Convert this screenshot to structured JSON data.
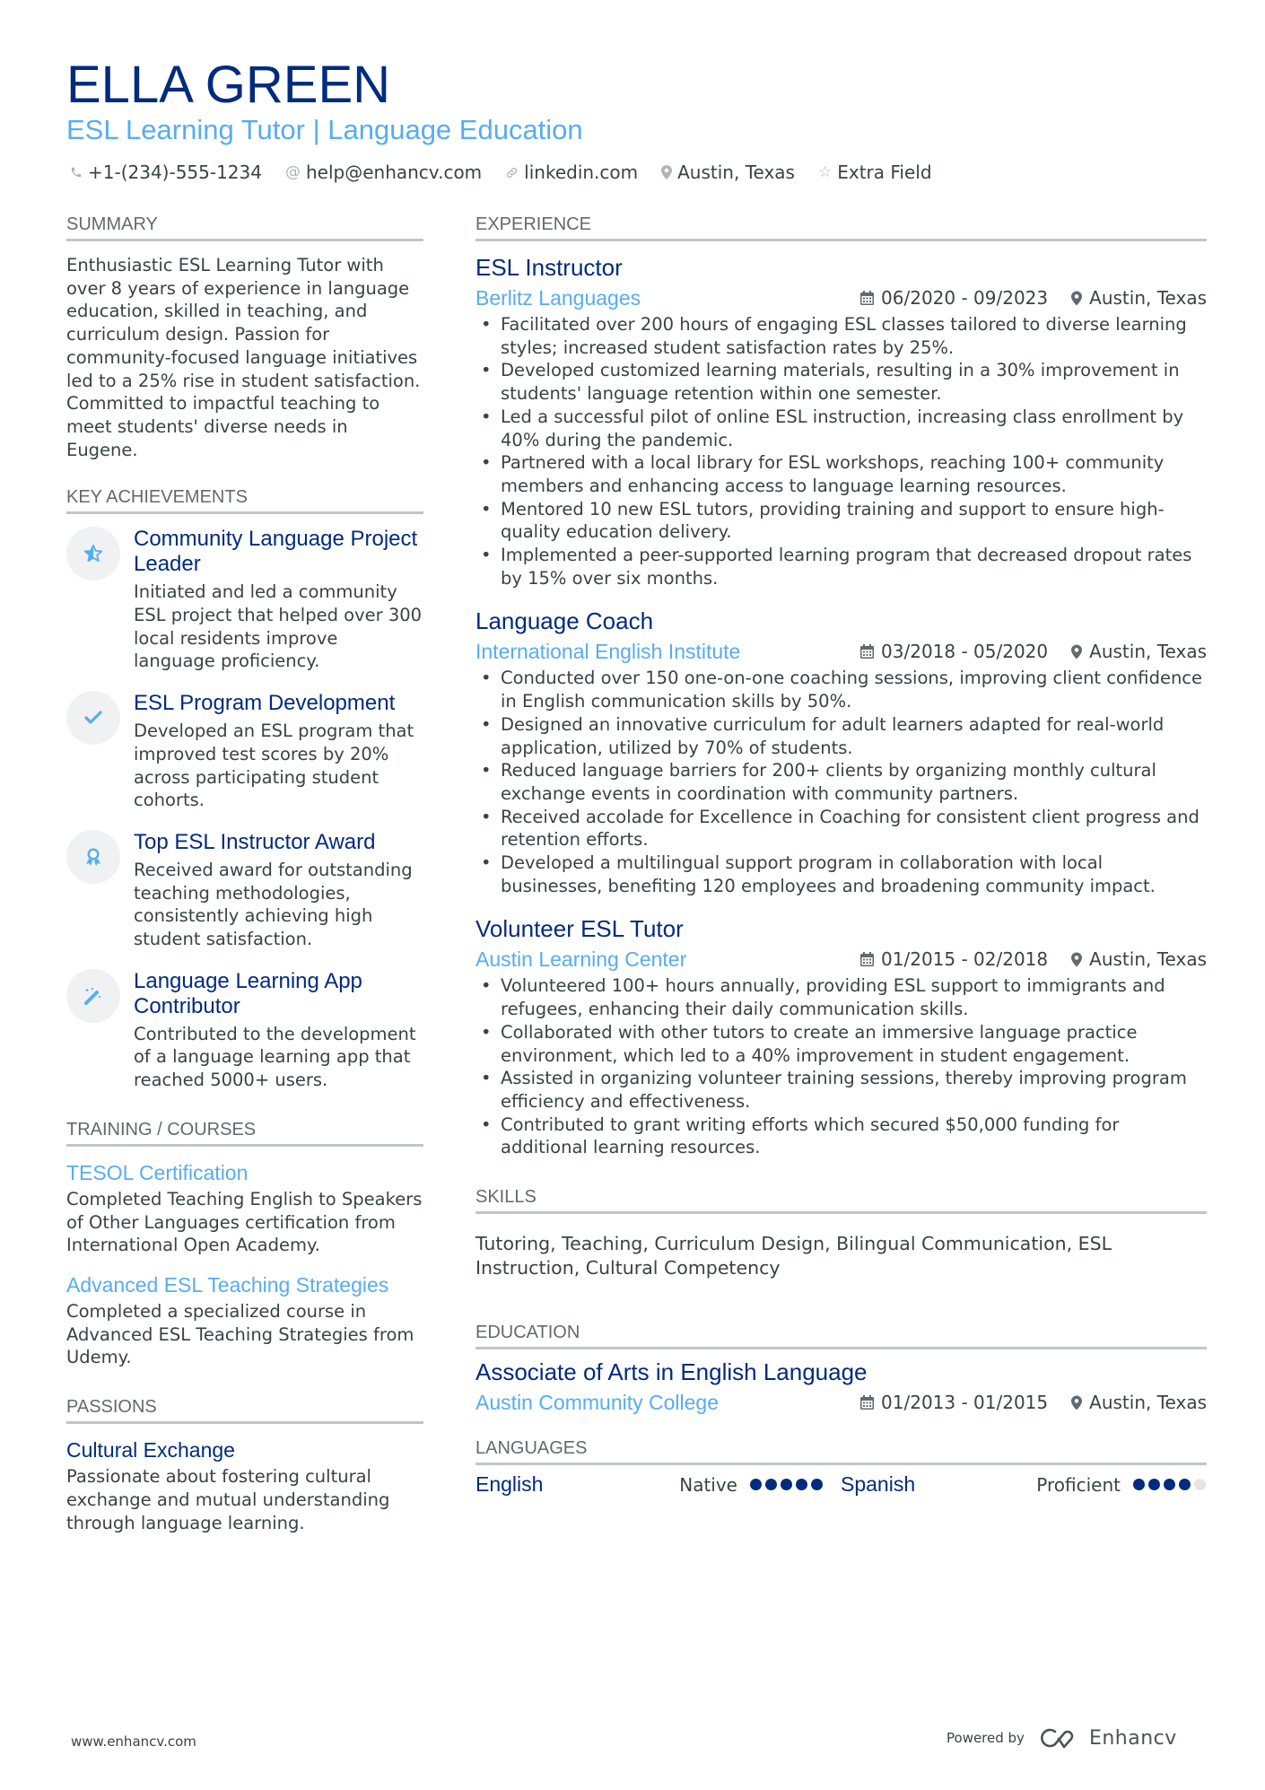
{
  "header": {
    "name": "ELLA GREEN",
    "title": "ESL Learning Tutor | Language Education",
    "contacts": [
      {
        "icon": "phone-icon",
        "text": "+1-(234)-555-1234"
      },
      {
        "icon": "at-icon",
        "text": "help@enhancv.com"
      },
      {
        "icon": "link-icon",
        "text": "linkedin.com"
      },
      {
        "icon": "location-pin-icon",
        "text": "Austin, Texas"
      },
      {
        "icon": "star-icon",
        "text": "Extra Field"
      }
    ]
  },
  "summary": {
    "heading": "SUMMARY",
    "text": "Enthusiastic ESL Learning Tutor with over 8 years of experience in language education, skilled in teaching, and curriculum design. Passion for community-focused language initiatives led to a 25% rise in student satisfaction. Committed to impactful teaching to meet students' diverse needs in Eugene."
  },
  "achievements": {
    "heading": "KEY ACHIEVEMENTS",
    "items": [
      {
        "icon": "star-half-icon",
        "title": "Community Language Project Leader",
        "text": "Initiated and led a community ESL project that helped over 300 local residents improve language proficiency."
      },
      {
        "icon": "checkmark-icon",
        "title": "ESL Program Development",
        "text": "Developed an ESL program that improved test scores by 20% across participating student cohorts."
      },
      {
        "icon": "award-ribbon-icon",
        "title": "Top ESL Instructor Award",
        "text": "Received award for outstanding teaching methodologies, consistently achieving high student satisfaction."
      },
      {
        "icon": "magic-wand-icon",
        "title": "Language Learning App Contributor",
        "text": "Contributed to the development of a language learning app that reached 5000+ users."
      }
    ]
  },
  "training": {
    "heading": "TRAINING / COURSES",
    "items": [
      {
        "title": "TESOL Certification",
        "text": "Completed Teaching English to Speakers of Other Languages certification from International Open Academy."
      },
      {
        "title": "Advanced ESL Teaching Strategies",
        "text": "Completed a specialized course in Advanced ESL Teaching Strategies from Udemy."
      }
    ]
  },
  "passions": {
    "heading": "PASSIONS",
    "items": [
      {
        "title": "Cultural Exchange",
        "text": "Passionate about fostering cultural exchange and mutual understanding through language learning."
      }
    ]
  },
  "experience": {
    "heading": "EXPERIENCE",
    "jobs": [
      {
        "title": "ESL Instructor",
        "company": "Berlitz Languages",
        "dates": "06/2020 - 09/2023",
        "location": "Austin, Texas",
        "bullets": [
          "Facilitated over 200 hours of engaging ESL classes tailored to diverse learning styles; increased student satisfaction rates by 25%.",
          "Developed customized learning materials, resulting in a 30% improvement in students' language retention within one semester.",
          "Led a successful pilot of online ESL instruction, increasing class enrollment by 40% during the pandemic.",
          "Partnered with a local library for ESL workshops, reaching 100+ community members and enhancing access to language learning resources.",
          "Mentored 10 new ESL tutors, providing training and support to ensure high-quality education delivery.",
          "Implemented a peer-supported learning program that decreased dropout rates by 15% over six months."
        ]
      },
      {
        "title": "Language Coach",
        "company": "International English Institute",
        "dates": "03/2018 - 05/2020",
        "location": "Austin, Texas",
        "bullets": [
          "Conducted over 150 one-on-one coaching sessions, improving client confidence in English communication skills by 50%.",
          "Designed an innovative curriculum for adult learners adapted for real-world application, utilized by 70% of students.",
          "Reduced language barriers for 200+ clients by organizing monthly cultural exchange events in coordination with community partners.",
          "Received accolade for Excellence in Coaching for consistent client progress and retention efforts.",
          "Developed a multilingual support program in collaboration with local businesses, benefiting 120 employees and broadening community impact."
        ]
      },
      {
        "title": "Volunteer ESL Tutor",
        "company": "Austin Learning Center",
        "dates": "01/2015 - 02/2018",
        "location": "Austin, Texas",
        "bullets": [
          "Volunteered 100+ hours annually, providing ESL support to immigrants and refugees, enhancing their daily communication skills.",
          "Collaborated with other tutors to create an immersive language practice environment, which led to a 40% improvement in student engagement.",
          "Assisted in organizing volunteer training sessions, thereby improving program efficiency and effectiveness.",
          "Contributed to grant writing efforts which secured $50,000 funding for additional learning resources."
        ]
      }
    ]
  },
  "skills": {
    "heading": "SKILLS",
    "text": "Tutoring, Teaching, Curriculum Design, Bilingual Communication, ESL Instruction, Cultural Competency"
  },
  "education": {
    "heading": "EDUCATION",
    "items": [
      {
        "degree": "Associate of Arts in English Language",
        "school": "Austin Community College",
        "dates": "01/2013 - 01/2015",
        "location": "Austin, Texas"
      }
    ]
  },
  "languages": {
    "heading": "LANGUAGES",
    "items": [
      {
        "name": "English",
        "level": "Native",
        "rating": 5,
        "max": 5
      },
      {
        "name": "Spanish",
        "level": "Proficient",
        "rating": 4,
        "max": 5
      }
    ]
  },
  "footer": {
    "website": "www.enhancv.com",
    "powered_by": "Powered by",
    "brand": "Enhancv"
  },
  "colors": {
    "name": "#002b7f",
    "accent": "#56acf2",
    "text": "#384347",
    "rule": "#c2c5c8"
  }
}
